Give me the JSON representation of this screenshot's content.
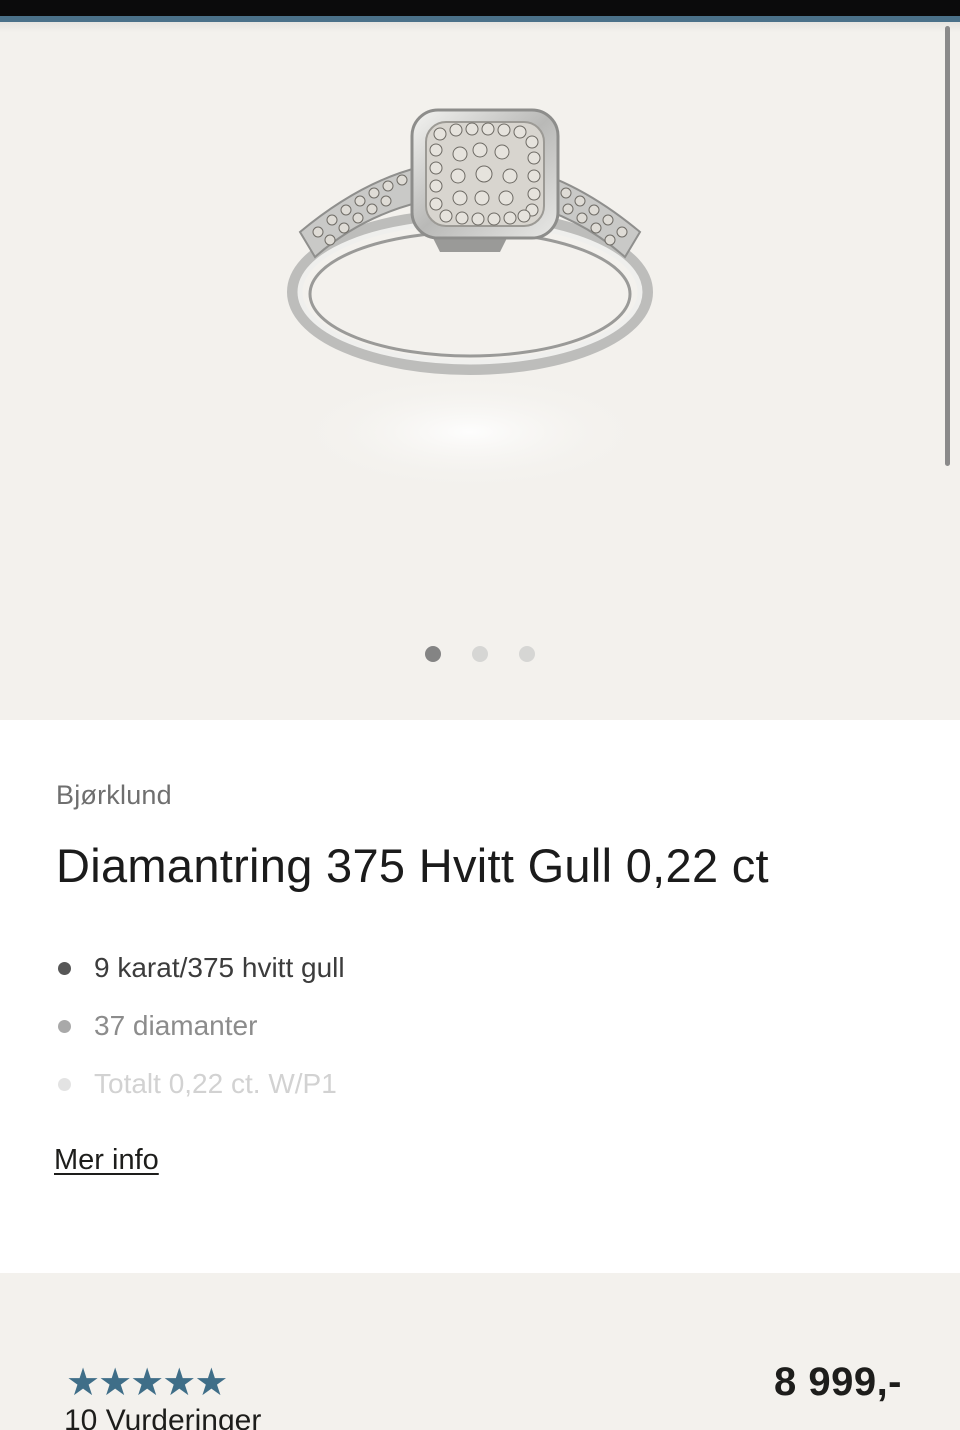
{
  "product": {
    "brand": "Bjørklund",
    "title": "Diamantring 375 Hvitt Gull 0,22 ct",
    "features": [
      "9 karat/375 hvitt gull",
      "37 diamanter",
      "Totalt 0,22 ct. W/P1"
    ],
    "more_info_label": "Mer info",
    "price": "8 999,-",
    "rating": {
      "stars": 5,
      "reviews_label": "10 Vurderinger"
    }
  },
  "gallery": {
    "image_count": 3,
    "active_index": 0,
    "image_icon": "diamond-ring-image"
  },
  "colors": {
    "accent": "#4b7189",
    "star": "#3f6e88",
    "gallery_bg": "#f3f1ed"
  }
}
